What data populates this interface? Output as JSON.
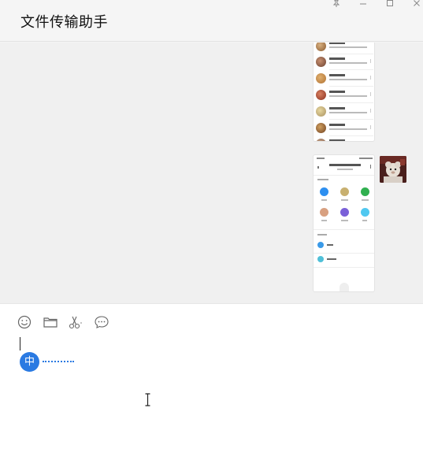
{
  "window": {
    "title": "文件传输助手",
    "controls": {
      "pin_icon": "pin-icon",
      "minimize_icon": "minimize-icon",
      "maximize_icon": "maximize-icon",
      "close_icon": "close-icon"
    }
  },
  "chat": {
    "messages": [
      {
        "type": "image",
        "sender": "self",
        "content": "phone-screenshot-contacts-list"
      },
      {
        "type": "image",
        "sender": "self",
        "content": "phone-screenshot-app-menu"
      }
    ]
  },
  "input_area": {
    "toolbar": [
      {
        "name": "emoji-button",
        "icon": "smiley-icon"
      },
      {
        "name": "file-button",
        "icon": "folder-icon"
      },
      {
        "name": "screenshot-button",
        "icon": "scissors-icon"
      },
      {
        "name": "chat-history-button",
        "icon": "speech-bubble-icon"
      }
    ],
    "text_value": "",
    "ime_indicator": "中"
  },
  "colors": {
    "accent": "#2a7ae2",
    "window_bg": "#f5f5f5",
    "chat_bg": "#f0f0f0",
    "input_bg": "#ffffff"
  }
}
